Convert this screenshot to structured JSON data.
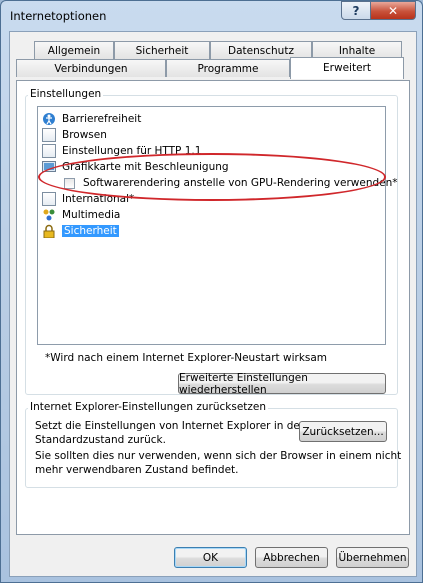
{
  "window": {
    "title": "Internetoptionen",
    "help_label": "?",
    "close_label": "✕"
  },
  "tabs_row1": [
    "Allgemein",
    "Sicherheit",
    "Datenschutz",
    "Inhalte"
  ],
  "tabs_row2": [
    "Verbindungen",
    "Programme",
    "Erweitert"
  ],
  "settings": {
    "group_label": "Einstellungen",
    "items": [
      {
        "label": "Barrierefreiheit",
        "icon": "accessibility-icon"
      },
      {
        "label": "Browsen",
        "icon": "document-icon"
      },
      {
        "label": "Einstellungen für HTTP 1.1",
        "icon": "document-icon"
      },
      {
        "label": "Grafikkarte mit Beschleunigung",
        "icon": "display-icon"
      },
      {
        "label": "Softwarerendering anstelle von GPU-Rendering verwenden*",
        "icon": "checkbox",
        "checked": false
      },
      {
        "label": "International*",
        "icon": "document-icon"
      },
      {
        "label": "Multimedia",
        "icon": "multimedia-icon"
      },
      {
        "label": "Sicherheit",
        "icon": "lock-icon",
        "selected": true
      }
    ],
    "restart_note": "*Wird nach einem Internet Explorer-Neustart wirksam",
    "restore_button": "Erweiterte Einstellungen wiederherstellen"
  },
  "reset": {
    "group_label": "Internet Explorer-Einstellungen zurücksetzen",
    "description_line1": "Setzt die Einstellungen von Internet Explorer in den",
    "description_line2": "Standardzustand zurück.",
    "button": "Zurücksetzen...",
    "warning_line1": "Sie sollten dies nur verwenden, wenn sich der Browser in einem nicht",
    "warning_line2": "mehr verwendbaren Zustand befindet."
  },
  "footer": {
    "ok": "OK",
    "cancel": "Abbrechen",
    "apply": "Übernehmen"
  },
  "colors": {
    "annotation": "#d0272b",
    "selection": "#3399ff"
  }
}
